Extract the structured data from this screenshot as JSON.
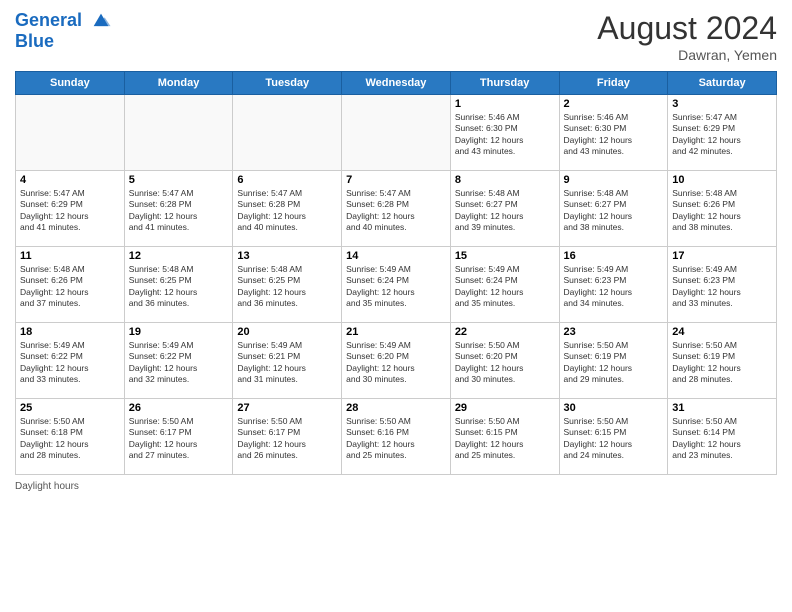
{
  "logo": {
    "line1": "General",
    "line2": "Blue"
  },
  "title": "August 2024",
  "location": "Dawran, Yemen",
  "days_of_week": [
    "Sunday",
    "Monday",
    "Tuesday",
    "Wednesday",
    "Thursday",
    "Friday",
    "Saturday"
  ],
  "footer": "Daylight hours",
  "weeks": [
    [
      {
        "day": "",
        "info": ""
      },
      {
        "day": "",
        "info": ""
      },
      {
        "day": "",
        "info": ""
      },
      {
        "day": "",
        "info": ""
      },
      {
        "day": "1",
        "info": "Sunrise: 5:46 AM\nSunset: 6:30 PM\nDaylight: 12 hours\nand 43 minutes."
      },
      {
        "day": "2",
        "info": "Sunrise: 5:46 AM\nSunset: 6:30 PM\nDaylight: 12 hours\nand 43 minutes."
      },
      {
        "day": "3",
        "info": "Sunrise: 5:47 AM\nSunset: 6:29 PM\nDaylight: 12 hours\nand 42 minutes."
      }
    ],
    [
      {
        "day": "4",
        "info": "Sunrise: 5:47 AM\nSunset: 6:29 PM\nDaylight: 12 hours\nand 41 minutes."
      },
      {
        "day": "5",
        "info": "Sunrise: 5:47 AM\nSunset: 6:28 PM\nDaylight: 12 hours\nand 41 minutes."
      },
      {
        "day": "6",
        "info": "Sunrise: 5:47 AM\nSunset: 6:28 PM\nDaylight: 12 hours\nand 40 minutes."
      },
      {
        "day": "7",
        "info": "Sunrise: 5:47 AM\nSunset: 6:28 PM\nDaylight: 12 hours\nand 40 minutes."
      },
      {
        "day": "8",
        "info": "Sunrise: 5:48 AM\nSunset: 6:27 PM\nDaylight: 12 hours\nand 39 minutes."
      },
      {
        "day": "9",
        "info": "Sunrise: 5:48 AM\nSunset: 6:27 PM\nDaylight: 12 hours\nand 38 minutes."
      },
      {
        "day": "10",
        "info": "Sunrise: 5:48 AM\nSunset: 6:26 PM\nDaylight: 12 hours\nand 38 minutes."
      }
    ],
    [
      {
        "day": "11",
        "info": "Sunrise: 5:48 AM\nSunset: 6:26 PM\nDaylight: 12 hours\nand 37 minutes."
      },
      {
        "day": "12",
        "info": "Sunrise: 5:48 AM\nSunset: 6:25 PM\nDaylight: 12 hours\nand 36 minutes."
      },
      {
        "day": "13",
        "info": "Sunrise: 5:48 AM\nSunset: 6:25 PM\nDaylight: 12 hours\nand 36 minutes."
      },
      {
        "day": "14",
        "info": "Sunrise: 5:49 AM\nSunset: 6:24 PM\nDaylight: 12 hours\nand 35 minutes."
      },
      {
        "day": "15",
        "info": "Sunrise: 5:49 AM\nSunset: 6:24 PM\nDaylight: 12 hours\nand 35 minutes."
      },
      {
        "day": "16",
        "info": "Sunrise: 5:49 AM\nSunset: 6:23 PM\nDaylight: 12 hours\nand 34 minutes."
      },
      {
        "day": "17",
        "info": "Sunrise: 5:49 AM\nSunset: 6:23 PM\nDaylight: 12 hours\nand 33 minutes."
      }
    ],
    [
      {
        "day": "18",
        "info": "Sunrise: 5:49 AM\nSunset: 6:22 PM\nDaylight: 12 hours\nand 33 minutes."
      },
      {
        "day": "19",
        "info": "Sunrise: 5:49 AM\nSunset: 6:22 PM\nDaylight: 12 hours\nand 32 minutes."
      },
      {
        "day": "20",
        "info": "Sunrise: 5:49 AM\nSunset: 6:21 PM\nDaylight: 12 hours\nand 31 minutes."
      },
      {
        "day": "21",
        "info": "Sunrise: 5:49 AM\nSunset: 6:20 PM\nDaylight: 12 hours\nand 30 minutes."
      },
      {
        "day": "22",
        "info": "Sunrise: 5:50 AM\nSunset: 6:20 PM\nDaylight: 12 hours\nand 30 minutes."
      },
      {
        "day": "23",
        "info": "Sunrise: 5:50 AM\nSunset: 6:19 PM\nDaylight: 12 hours\nand 29 minutes."
      },
      {
        "day": "24",
        "info": "Sunrise: 5:50 AM\nSunset: 6:19 PM\nDaylight: 12 hours\nand 28 minutes."
      }
    ],
    [
      {
        "day": "25",
        "info": "Sunrise: 5:50 AM\nSunset: 6:18 PM\nDaylight: 12 hours\nand 28 minutes."
      },
      {
        "day": "26",
        "info": "Sunrise: 5:50 AM\nSunset: 6:17 PM\nDaylight: 12 hours\nand 27 minutes."
      },
      {
        "day": "27",
        "info": "Sunrise: 5:50 AM\nSunset: 6:17 PM\nDaylight: 12 hours\nand 26 minutes."
      },
      {
        "day": "28",
        "info": "Sunrise: 5:50 AM\nSunset: 6:16 PM\nDaylight: 12 hours\nand 25 minutes."
      },
      {
        "day": "29",
        "info": "Sunrise: 5:50 AM\nSunset: 6:15 PM\nDaylight: 12 hours\nand 25 minutes."
      },
      {
        "day": "30",
        "info": "Sunrise: 5:50 AM\nSunset: 6:15 PM\nDaylight: 12 hours\nand 24 minutes."
      },
      {
        "day": "31",
        "info": "Sunrise: 5:50 AM\nSunset: 6:14 PM\nDaylight: 12 hours\nand 23 minutes."
      }
    ]
  ]
}
